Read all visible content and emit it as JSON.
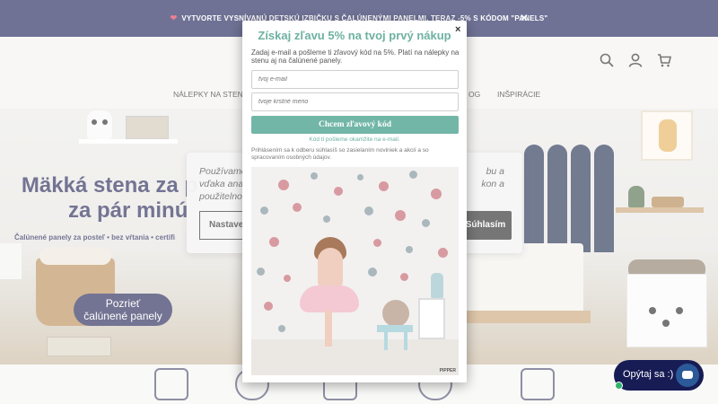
{
  "announcement": {
    "text": "VYTVORTE VYSNÍVANÚ DETSKÚ IZBIČKU S ČALÚNENÝMI PANELMI, TERAZ -5% S KÓDOM \"PANELS\"",
    "heart_icon": "heart-icon",
    "close_icon": "close-icon",
    "close_glyph": "✕"
  },
  "header": {
    "icons": [
      "search-icon",
      "user-icon",
      "cart-icon"
    ],
    "nav": {
      "left": "NÁLEPKY NA STENU",
      "mid": "OG",
      "right": "INŠPIRÁCIE"
    }
  },
  "hero": {
    "headline_line1": "Mäkká stena za p",
    "headline_line2": "za pár minú",
    "subline": "Čalúnené panely za posteľ • bez vŕtania • certifi",
    "cta_line1": "Pozrieť",
    "cta_line2": "čalúnené panely"
  },
  "cookie_banner": {
    "text_line1": "Používame",
    "text_line1_right": "bu a",
    "text_line2": "vďaka ana",
    "text_line2_right": "kon a",
    "text_line3": "použitelno",
    "settings_button": "Nastave",
    "accept_button": "Súhlasím"
  },
  "popup": {
    "close_glyph": "×",
    "title": "Získaj zľavu 5% na tvoj prvý nákup",
    "description": "Zadaj e-mail a pošleme ti zľavový kód na 5%. Platí na nálepky na stenu aj na čalúnené panely.",
    "email_placeholder": "tvoj e-mail",
    "name_placeholder": "tvoje krstné meno",
    "submit_label": "Chcem zľavový kód",
    "sent_note": "Kód ti pošleme okamžite na e-mail.",
    "consent": "Prihlásením sa k odberu súhlasíš so zasielaním noviniek a akcií a so spracovaním osobných údajov.",
    "image_brand": "PIPPER"
  },
  "chat_widget": {
    "label": "Opýtaj sa :)",
    "icon": "chat-bubble-icon",
    "status_color": "#2fb36a"
  },
  "bottom_bar": {
    "icons": [
      "family-icon",
      "map-icon",
      "gift-icon",
      "award-icon",
      "care-hands-icon"
    ]
  },
  "colors": {
    "brand_navy": "#171c55",
    "accent_mint": "#72b6a7",
    "popup_title": "#6db1a2"
  }
}
